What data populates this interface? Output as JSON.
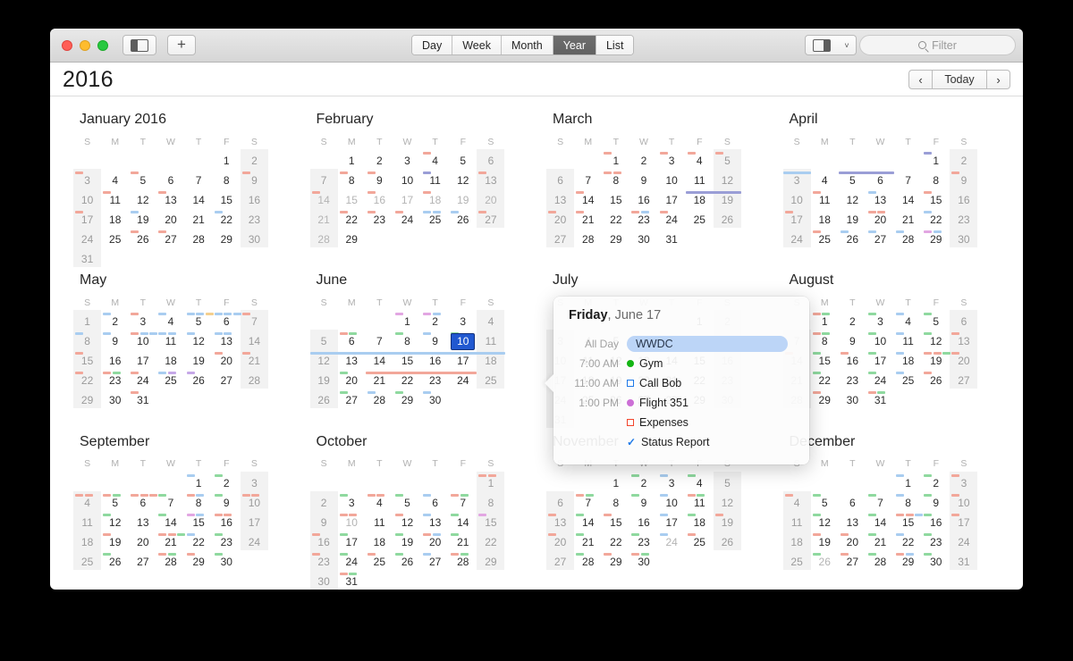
{
  "window": {
    "traffic_lights": [
      "close",
      "minimize",
      "zoom"
    ],
    "sidebar_toggle": "sidebar-toggle",
    "add_label": "+",
    "view_tabs": [
      {
        "label": "Day",
        "active": false
      },
      {
        "label": "Week",
        "active": false
      },
      {
        "label": "Month",
        "active": false
      },
      {
        "label": "Year",
        "active": true
      },
      {
        "label": "List",
        "active": false
      }
    ],
    "calendars_toggle": "calendar-list-toggle",
    "calendars_arrow": "˅",
    "filter_placeholder": "Filter"
  },
  "header": {
    "year": "2016",
    "prev": "‹",
    "today": "Today",
    "next": "›"
  },
  "colors": {
    "red": "#f2a79a",
    "green": "#8fd99f",
    "blue": "#a9cdf0",
    "purple": "#c6a8e8",
    "magenta": "#e2a6e2",
    "yellow": "#f4cf8e",
    "indigo": "#9a9ed6",
    "selection": "#2158d0",
    "accent_pill": "#bcd5f7"
  },
  "dow": [
    "S",
    "M",
    "T",
    "W",
    "T",
    "F",
    "S"
  ],
  "months": [
    {
      "name": "January 2016",
      "start": 5,
      "days": 31,
      "dim": [],
      "events": {
        "3": [
          "red"
        ],
        "5": [
          "red"
        ],
        "9": [
          "red"
        ],
        "11": [
          "red"
        ],
        "13": [
          "red"
        ],
        "17": [
          "red"
        ],
        "19": [
          "blue"
        ],
        "22": [
          "blue"
        ],
        "26": [
          "red"
        ],
        "27": [
          "red"
        ]
      },
      "spans": []
    },
    {
      "name": "February",
      "start": 1,
      "days": 29,
      "dim": [
        14,
        15,
        16,
        17,
        18,
        19,
        20,
        21,
        28
      ],
      "events": {
        "4": [
          "red"
        ],
        "8": [
          "red"
        ],
        "9": [
          "red"
        ],
        "11": [
          "indigo"
        ],
        "13": [
          "red"
        ],
        "14": [
          "red"
        ],
        "16": [
          "red"
        ],
        "18": [
          "red"
        ],
        "22": [
          "red"
        ],
        "23": [
          "red"
        ],
        "24": [
          "red"
        ],
        "25": [
          "blue",
          "blue"
        ],
        "26": [
          "blue"
        ],
        "27": [
          "red"
        ]
      },
      "spans": []
    },
    {
      "name": "March",
      "start": 2,
      "days": 31,
      "dim": [],
      "events": {
        "1": [
          "red"
        ],
        "3": [
          "red"
        ],
        "4": [
          "red"
        ],
        "5": [
          "red"
        ],
        "8": [
          "red",
          "red"
        ],
        "14": [
          "red"
        ],
        "18": [
          "red"
        ],
        "19": [
          "red"
        ],
        "20": [
          "red"
        ],
        "21": [
          "red"
        ],
        "23": [
          "red",
          "blue"
        ],
        "24": [
          "red"
        ]
      },
      "spans": [
        {
          "row": 3,
          "col_start": 5,
          "col_end": 6,
          "color": "indigo"
        }
      ]
    },
    {
      "name": "April",
      "start": 5,
      "days": 30,
      "dim": [],
      "events": {
        "1": [
          "indigo"
        ],
        "9": [
          "red"
        ],
        "11": [
          "red"
        ],
        "13": [
          "blue"
        ],
        "15": [
          "red"
        ],
        "17": [
          "red"
        ],
        "20": [
          "red",
          "red"
        ],
        "22": [
          "blue"
        ],
        "25": [
          "red"
        ],
        "26": [
          "blue"
        ],
        "27": [
          "blue"
        ],
        "28": [
          "blue"
        ],
        "29": [
          "magenta",
          "blue"
        ]
      },
      "spans": [
        {
          "row": 2,
          "col_start": 0,
          "col_end": 0,
          "color": "blue"
        },
        {
          "row": 2,
          "col_start": 2,
          "col_end": 3,
          "color": "indigo"
        }
      ]
    },
    {
      "name": "May",
      "start": 0,
      "days": 31,
      "dim": [],
      "events": {
        "2": [
          "blue"
        ],
        "3": [
          "red"
        ],
        "4": [
          "blue"
        ],
        "5": [
          "blue",
          "blue",
          "yellow"
        ],
        "6": [
          "blue",
          "blue",
          "blue"
        ],
        "7": [
          "red"
        ],
        "8": [
          "blue"
        ],
        "9": [
          "blue"
        ],
        "10": [
          "red",
          "blue",
          "blue"
        ],
        "11": [
          "blue",
          "blue"
        ],
        "12": [
          "blue"
        ],
        "13": [
          "blue",
          "blue"
        ],
        "15": [
          "red"
        ],
        "20": [
          "red"
        ],
        "21": [
          "red"
        ],
        "22": [
          "red"
        ],
        "23": [
          "red",
          "green"
        ],
        "24": [
          "red"
        ],
        "25": [
          "blue",
          "purple"
        ],
        "26": [
          "purple"
        ],
        "31": [
          "red"
        ]
      },
      "spans": []
    },
    {
      "name": "June",
      "start": 3,
      "days": 30,
      "dim": [],
      "selected": 10,
      "events": {
        "1": [
          "magenta"
        ],
        "2": [
          "magenta",
          "blue"
        ],
        "6": [
          "red",
          "green"
        ],
        "8": [
          "green"
        ],
        "9": [
          "blue"
        ],
        "10": [
          "green"
        ],
        "13": [
          "green"
        ],
        "14": [
          "red"
        ],
        "15": [
          "red"
        ],
        "16": [
          "blue"
        ],
        "17": [
          "green"
        ],
        "20": [
          "green"
        ],
        "24": [
          "green"
        ],
        "27": [
          "green"
        ],
        "28": [
          "blue"
        ],
        "29": [
          "green"
        ],
        "30": [
          "blue"
        ]
      },
      "spans": [
        {
          "row": 3,
          "col_start": 0,
          "col_end": 6,
          "color": "blue"
        },
        {
          "row": 4,
          "col_start": 2,
          "col_end": 5,
          "color": "red"
        }
      ]
    },
    {
      "name": "July",
      "start": 5,
      "days": 31,
      "dim": [],
      "events": {},
      "spans": [],
      "obscured": true
    },
    {
      "name": "August",
      "start": 1,
      "days": 31,
      "dim": [],
      "events": {
        "1": [
          "red",
          "green"
        ],
        "3": [
          "green"
        ],
        "4": [
          "blue"
        ],
        "5": [
          "green"
        ],
        "8": [
          "red",
          "green"
        ],
        "10": [
          "green"
        ],
        "11": [
          "blue"
        ],
        "12": [
          "green"
        ],
        "13": [
          "red"
        ],
        "14": [
          "red"
        ],
        "15": [
          "green"
        ],
        "16": [
          "red"
        ],
        "17": [
          "green"
        ],
        "18": [
          "blue"
        ],
        "19": [
          "red",
          "red",
          "green"
        ],
        "20": [
          "red"
        ],
        "22": [
          "green"
        ],
        "24": [
          "green"
        ],
        "25": [
          "blue"
        ],
        "26": [
          "red"
        ],
        "29": [
          "red"
        ],
        "31": [
          "red",
          "green"
        ]
      },
      "spans": []
    },
    {
      "name": "September",
      "start": 4,
      "days": 30,
      "dim": [],
      "events": {
        "1": [
          "blue"
        ],
        "2": [
          "green"
        ],
        "4": [
          "red",
          "red"
        ],
        "5": [
          "red",
          "green"
        ],
        "6": [
          "red",
          "red",
          "red"
        ],
        "7": [
          "green"
        ],
        "8": [
          "red",
          "blue"
        ],
        "9": [
          "green"
        ],
        "10": [
          "red",
          "red"
        ],
        "12": [
          "green"
        ],
        "14": [
          "green"
        ],
        "15": [
          "magenta",
          "blue"
        ],
        "16": [
          "red",
          "red"
        ],
        "19": [
          "red"
        ],
        "21": [
          "red",
          "red",
          "green"
        ],
        "22": [
          "blue"
        ],
        "23": [
          "green"
        ],
        "26": [
          "green"
        ],
        "28": [
          "red",
          "green"
        ],
        "29": [
          "red"
        ],
        "30": [
          "green"
        ]
      },
      "spans": []
    },
    {
      "name": "October",
      "start": 6,
      "days": 31,
      "dim": [
        10
      ],
      "events": {
        "1": [
          "red",
          "red"
        ],
        "3": [
          "green"
        ],
        "4": [
          "red",
          "red"
        ],
        "5": [
          "green"
        ],
        "6": [
          "blue"
        ],
        "7": [
          "red",
          "green"
        ],
        "10": [
          "red",
          "red"
        ],
        "12": [
          "red"
        ],
        "13": [
          "blue"
        ],
        "14": [
          "green"
        ],
        "15": [
          "magenta"
        ],
        "16": [
          "red"
        ],
        "17": [
          "green"
        ],
        "19": [
          "green"
        ],
        "20": [
          "red",
          "blue"
        ],
        "21": [
          "green"
        ],
        "23": [
          "red"
        ],
        "24": [
          "green"
        ],
        "25": [
          "red"
        ],
        "26": [
          "green"
        ],
        "27": [
          "blue"
        ],
        "28": [
          "red",
          "green"
        ],
        "31": [
          "red",
          "green"
        ]
      },
      "spans": []
    },
    {
      "name": "November",
      "start": 2,
      "days": 30,
      "dim": [
        24
      ],
      "events": {
        "2": [
          "green"
        ],
        "3": [
          "blue"
        ],
        "4": [
          "green"
        ],
        "7": [
          "red",
          "green"
        ],
        "9": [
          "green"
        ],
        "10": [
          "blue"
        ],
        "11": [
          "red",
          "green"
        ],
        "13": [
          "red"
        ],
        "14": [
          "green"
        ],
        "15": [
          "red"
        ],
        "17": [
          "blue"
        ],
        "18": [
          "green"
        ],
        "19": [
          "red"
        ],
        "20": [
          "red"
        ],
        "21": [
          "green"
        ],
        "23": [
          "green"
        ],
        "24": [
          "blue"
        ],
        "25": [
          "red"
        ],
        "28": [
          "green"
        ],
        "29": [
          "red"
        ],
        "30": [
          "red",
          "green"
        ]
      },
      "spans": []
    },
    {
      "name": "December",
      "start": 4,
      "days": 31,
      "dim": [
        26
      ],
      "events": {
        "1": [
          "blue"
        ],
        "2": [
          "green"
        ],
        "3": [
          "red"
        ],
        "4": [
          "red"
        ],
        "5": [
          "green"
        ],
        "7": [
          "green"
        ],
        "8": [
          "blue"
        ],
        "9": [
          "green"
        ],
        "10": [
          "red"
        ],
        "12": [
          "green"
        ],
        "14": [
          "green"
        ],
        "15": [
          "red",
          "red",
          "blue"
        ],
        "16": [
          "green"
        ],
        "17": [
          "red"
        ],
        "19": [
          "red"
        ],
        "20": [
          "red"
        ],
        "21": [
          "green"
        ],
        "22": [
          "blue"
        ],
        "23": [
          "green"
        ],
        "26": [
          "green"
        ],
        "27": [
          "red"
        ],
        "28": [
          "green"
        ],
        "29": [
          "red",
          "blue"
        ],
        "30": [
          "green"
        ]
      },
      "spans": []
    }
  ],
  "popover": {
    "weekday": "Friday",
    "date_rest": ", June 17",
    "events": [
      {
        "time": "All Day",
        "title": "WWDC",
        "icon": "pill",
        "color": "#bcd5f7"
      },
      {
        "time": "7:00 AM",
        "title": "Gym",
        "icon": "dot",
        "color": "#13b513"
      },
      {
        "time": "11:00 AM",
        "title": "Call Bob",
        "icon": "square",
        "color": "#1e79e8"
      },
      {
        "time": "1:00 PM",
        "title": "Flight 351",
        "icon": "dot",
        "color": "#cc6fd6"
      },
      {
        "time": "",
        "title": "Expenses",
        "icon": "square",
        "color": "#f2452c"
      },
      {
        "time": "",
        "title": "Status Report",
        "icon": "check",
        "color": "#1e79e8"
      }
    ]
  }
}
